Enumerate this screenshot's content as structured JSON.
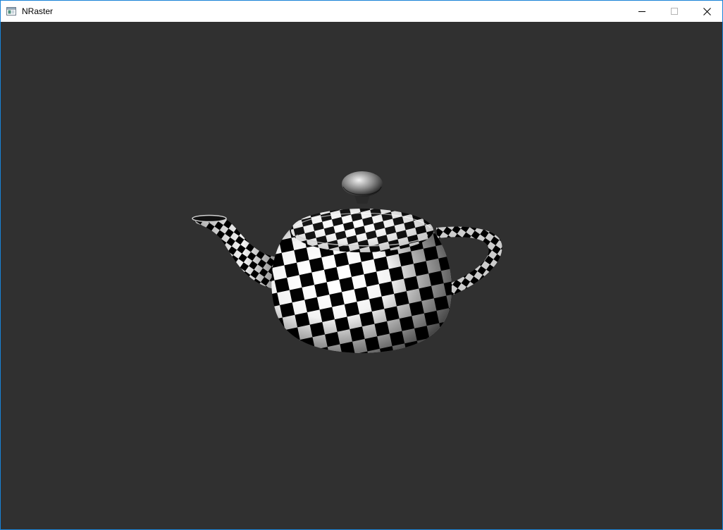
{
  "window": {
    "title": "NRaster",
    "app_icon": "window-app-icon",
    "controls": [
      "minimize-icon",
      "maximize-icon",
      "close-icon"
    ]
  },
  "viewport": {
    "background": "#303030",
    "object": "teapot-icon",
    "texture": "checkerboard",
    "texture_colors": [
      "#000000",
      "#ffffff"
    ]
  }
}
